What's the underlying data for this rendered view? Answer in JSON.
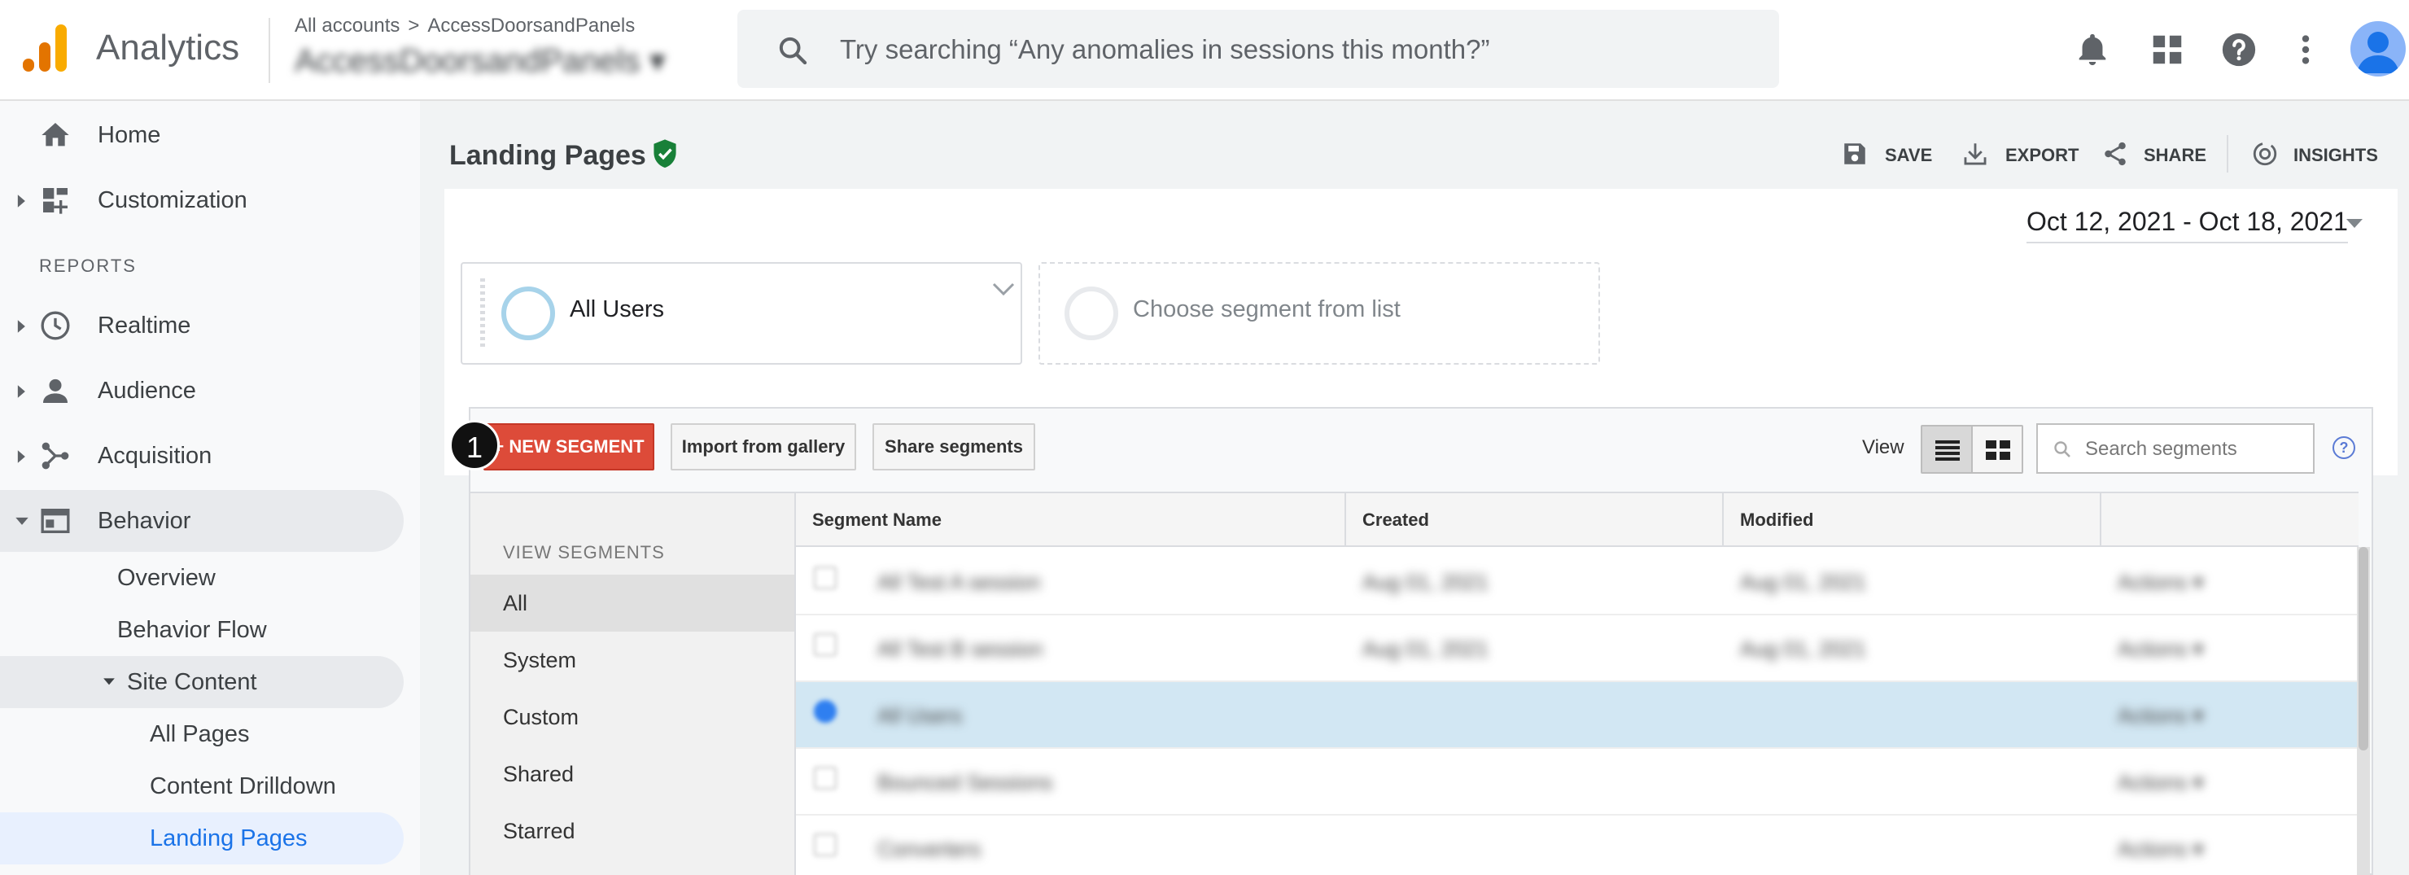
{
  "app": {
    "title": "Analytics",
    "brand_colors": [
      "#f9ab00",
      "#e37400"
    ]
  },
  "account": {
    "breadcrumb_root": "All accounts",
    "breadcrumb_sep": ">",
    "breadcrumb_property": "AccessDoorsandPanels",
    "selected_view": "AccessDoorsandPanels"
  },
  "search": {
    "placeholder": "Try searching “Any anomalies in sessions this month?”"
  },
  "topbar_icons": [
    "bell-icon",
    "apps-grid-icon",
    "help-icon",
    "more-vert-icon",
    "avatar"
  ],
  "sidebar": {
    "top_items": [
      {
        "label": "Home",
        "icon": "home-icon"
      },
      {
        "label": "Customization",
        "icon": "dashboard-icon"
      }
    ],
    "reports_label": "REPORTS",
    "report_items": [
      {
        "label": "Realtime",
        "icon": "clock-icon"
      },
      {
        "label": "Audience",
        "icon": "person-icon"
      },
      {
        "label": "Acquisition",
        "icon": "acquisition-icon"
      },
      {
        "label": "Behavior",
        "icon": "behavior-icon"
      }
    ],
    "behavior_sub": [
      {
        "label": "Overview"
      },
      {
        "label": "Behavior Flow"
      },
      {
        "label": "Site Content"
      }
    ],
    "site_content_sub": [
      {
        "label": "All Pages"
      },
      {
        "label": "Content Drilldown"
      },
      {
        "label": "Landing Pages"
      }
    ]
  },
  "page": {
    "title": "Landing Pages",
    "actions": {
      "save": "SAVE",
      "export": "EXPORT",
      "share": "SHARE",
      "insights": "INSIGHTS"
    },
    "date_range": "Oct 12, 2021 - Oct 18, 2021"
  },
  "segments": {
    "selected": "All Users",
    "choose_placeholder": "Choose segment from list",
    "buttons": {
      "new": "+ NEW SEGMENT",
      "import": "Import from gallery",
      "share": "Share segments"
    },
    "step_badge": "1",
    "view_label": "View",
    "search_placeholder": "Search segments",
    "help": "?",
    "view_segments_title": "VIEW SEGMENTS",
    "view_segments": [
      "All",
      "System",
      "Custom",
      "Shared",
      "Starred"
    ],
    "table": {
      "headers": [
        "Segment Name",
        "Created",
        "Modified",
        ""
      ],
      "rows": [
        {
          "name": "All Test A session",
          "created": "Aug 01, 2021",
          "modified": "Aug 01, 2021",
          "action": "Actions ▾",
          "selected": false
        },
        {
          "name": "All Test B session",
          "created": "Aug 01, 2021",
          "modified": "Aug 01, 2021",
          "action": "Actions ▾",
          "selected": false
        },
        {
          "name": "All Users",
          "created": "",
          "modified": "",
          "action": "Actions ▾",
          "selected": true
        },
        {
          "name": "Bounced Sessions",
          "created": "",
          "modified": "",
          "action": "Actions ▾",
          "selected": false
        },
        {
          "name": "Converters",
          "created": "",
          "modified": "",
          "action": "Actions ▾",
          "selected": false
        }
      ]
    }
  }
}
